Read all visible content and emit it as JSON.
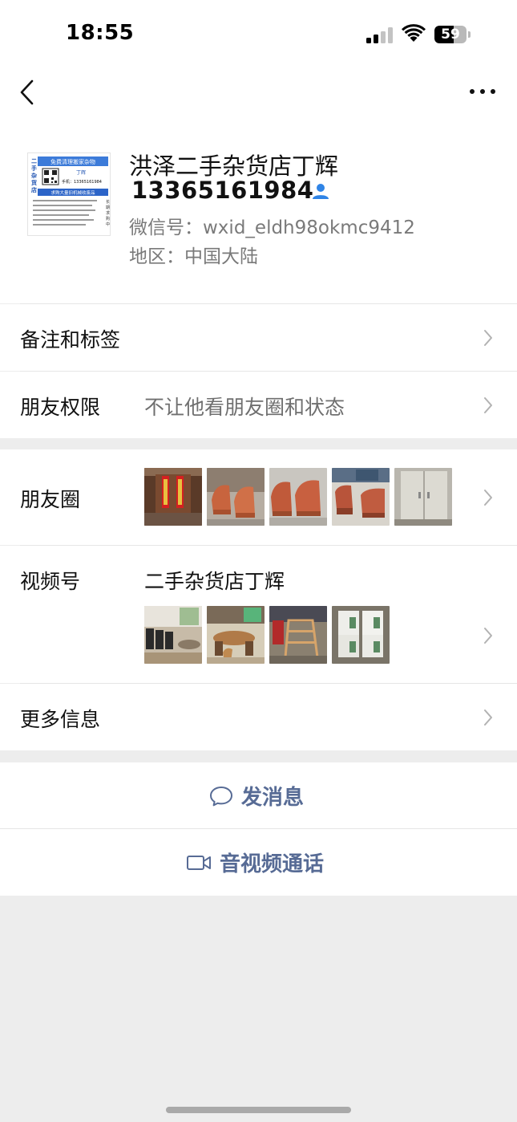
{
  "status_bar": {
    "time": "18:55",
    "battery_level": "59",
    "battery_fraction": 0.59
  },
  "nav": {
    "back_icon": "chevron-left-icon",
    "more_icon": "more-dots-icon"
  },
  "profile": {
    "name": "洪泽二手杂货店丁辉",
    "phone": "13365161984",
    "wechat_id": "微信号：wxid_eldh98okmc9412",
    "region": "地区：中国大陆",
    "avatar_card": {
      "vertical_title": "二手杂货店",
      "headline": "免费清理搬家杂物",
      "name": "丁辉",
      "phone": "手机：13365161984",
      "banner": "求购大量旧机械收废品",
      "side_text": "长期求购中"
    }
  },
  "rows": {
    "remarks_label": "备注和标签",
    "permissions_label": "朋友权限",
    "permissions_value": "不让他看朋友圈和状态",
    "moments_label": "朋友圈",
    "channels_label": "视频号",
    "channels_value": "二手杂货店丁辉",
    "more_info_label": "更多信息"
  },
  "actions": {
    "message_label": "发消息",
    "message_icon": "chat-bubble-icon",
    "call_label": "音视频通话",
    "call_icon": "video-camera-icon"
  },
  "colors": {
    "link_blue": "#576b95",
    "page_bg": "#ededed",
    "verified_blue": "#2f84e6"
  }
}
